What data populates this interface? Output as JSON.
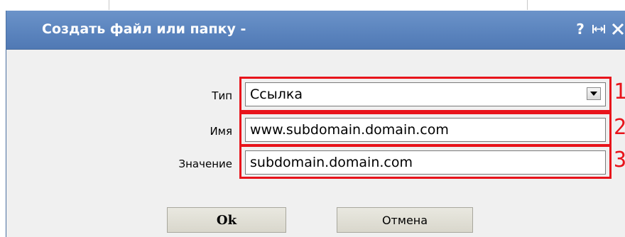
{
  "dialog": {
    "title": "Создать файл или папку -",
    "help_icon": "?",
    "icons": [
      "help-icon",
      "resize-icon",
      "close-icon"
    ]
  },
  "form": {
    "type_label": "Тип",
    "type_value": "Ссылка",
    "name_label": "Имя",
    "name_value": "www.subdomain.domain.com",
    "value_label": "Значение",
    "value_value": "subdomain.domain.com"
  },
  "annotations": {
    "marker_1": "1",
    "marker_2": "2",
    "marker_3": "3",
    "color": "#e8141b"
  },
  "buttons": {
    "ok_label": "Ok",
    "cancel_label": "Отмена"
  },
  "colors": {
    "titlebar": "#5a83bd",
    "dialog_bg": "#f0f0f0",
    "button_bg": "#e1e0d6"
  }
}
